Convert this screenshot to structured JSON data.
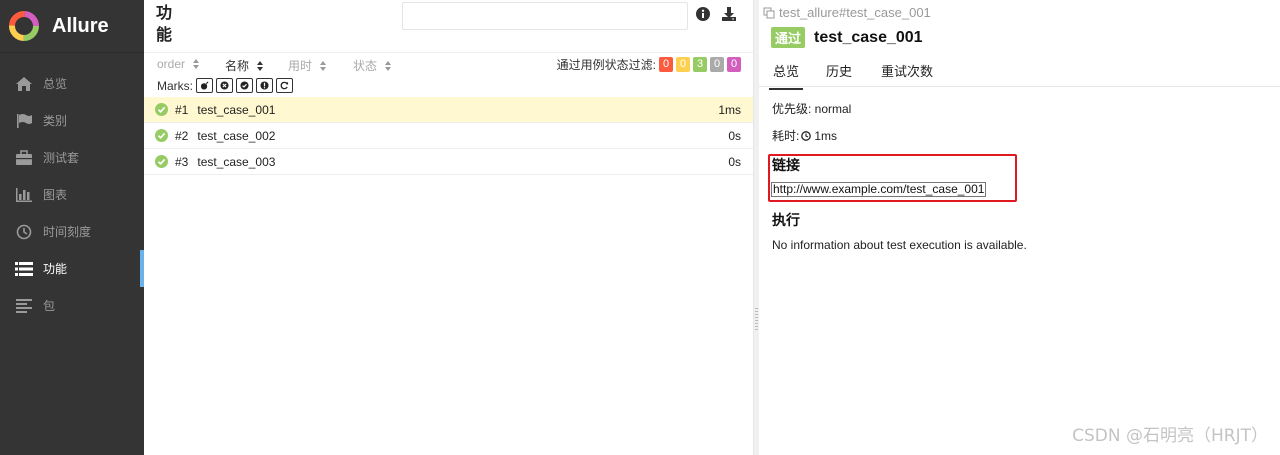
{
  "app": {
    "title": "Allure"
  },
  "sidebar": {
    "items": [
      {
        "label": "总览",
        "icon": "home-icon"
      },
      {
        "label": "类别",
        "icon": "flag-icon"
      },
      {
        "label": "测试套",
        "icon": "briefcase-icon"
      },
      {
        "label": "图表",
        "icon": "bar-chart-icon"
      },
      {
        "label": "时间刻度",
        "icon": "clock-icon"
      },
      {
        "label": "功能",
        "icon": "list-icon",
        "active": true
      },
      {
        "label": "包",
        "icon": "align-left-icon"
      }
    ]
  },
  "middle": {
    "title": "功能",
    "search": {
      "placeholder": "",
      "value": ""
    },
    "sort": {
      "order": "order",
      "name": "名称",
      "duration": "用时",
      "status": "状态"
    },
    "filter": {
      "label": "通过用例状态过滤:",
      "counts": [
        {
          "value": "0",
          "color": "#fd5a3e"
        },
        {
          "value": "0",
          "color": "#ffd050"
        },
        {
          "value": "3",
          "color": "#97cc64"
        },
        {
          "value": "0",
          "color": "#aaaaaa"
        },
        {
          "value": "0",
          "color": "#d35ebe"
        }
      ]
    },
    "marks_label": "Marks:",
    "rows": [
      {
        "num": "#1",
        "name": "test_case_001",
        "duration": "1ms",
        "selected": true
      },
      {
        "num": "#2",
        "name": "test_case_002",
        "duration": "0s"
      },
      {
        "num": "#3",
        "name": "test_case_003",
        "duration": "0s"
      }
    ]
  },
  "detail": {
    "breadcrumb": "test_allure#test_case_001",
    "status": "通过",
    "title": "test_case_001",
    "tabs": [
      "总览",
      "历史",
      "重试次数"
    ],
    "severity": "优先级: normal",
    "duration_label": "耗时:",
    "duration_value": "1ms",
    "links_heading": "链接",
    "link": "http://www.example.com/test_case_001",
    "exec_heading": "执行",
    "exec_note": "No information about test execution is available."
  },
  "watermark": "CSDN @石明亮（HRJT）"
}
